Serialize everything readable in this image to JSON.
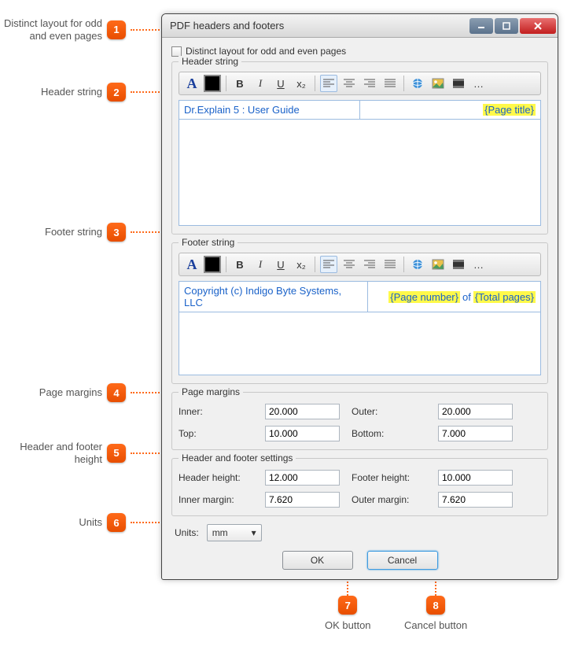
{
  "callouts": {
    "c1": "Distinct layout for odd and even pages",
    "c2": "Header string",
    "c3": "Footer string",
    "c4": "Page margins",
    "c5": "Header and footer height",
    "c6": "Units",
    "c7": "OK button",
    "c8": "Cancel button"
  },
  "dialog": {
    "title": "PDF headers and footers",
    "distinct_checkbox_label": "Distinct layout for odd and even pages"
  },
  "header_section": {
    "legend": "Header string",
    "left_text": "Dr.Explain 5 : User Guide",
    "right_placeholder": "{Page title}"
  },
  "footer_section": {
    "legend": "Footer string",
    "left_text": "Copyright (c) Indigo Byte Systems, LLC",
    "page_number_ph": "{Page number}",
    "of_text": " of ",
    "total_pages_ph": "{Total pages}"
  },
  "margins": {
    "legend": "Page margins",
    "inner_label": "Inner:",
    "inner_value": "20.000",
    "outer_label": "Outer:",
    "outer_value": "20.000",
    "top_label": "Top:",
    "top_value": "10.000",
    "bottom_label": "Bottom:",
    "bottom_value": "7.000"
  },
  "hf_settings": {
    "legend": "Header and footer settings",
    "header_height_label": "Header height:",
    "header_height_value": "12.000",
    "footer_height_label": "Footer height:",
    "footer_height_value": "10.000",
    "inner_margin_label": "Inner margin:",
    "inner_margin_value": "7.620",
    "outer_margin_label": "Outer margin:",
    "outer_margin_value": "7.620"
  },
  "units": {
    "label": "Units:",
    "selected": "mm"
  },
  "buttons": {
    "ok": "OK",
    "cancel": "Cancel"
  },
  "toolbar_icons": {
    "font": "A",
    "color": "color-swatch",
    "bold": "B",
    "italic": "I",
    "underline": "U",
    "subscript": "x₂",
    "align_left": "align-left",
    "align_center": "align-center",
    "align_right": "align-right",
    "align_justify": "align-justify",
    "link": "link",
    "image": "image",
    "video": "video",
    "more": "…"
  }
}
